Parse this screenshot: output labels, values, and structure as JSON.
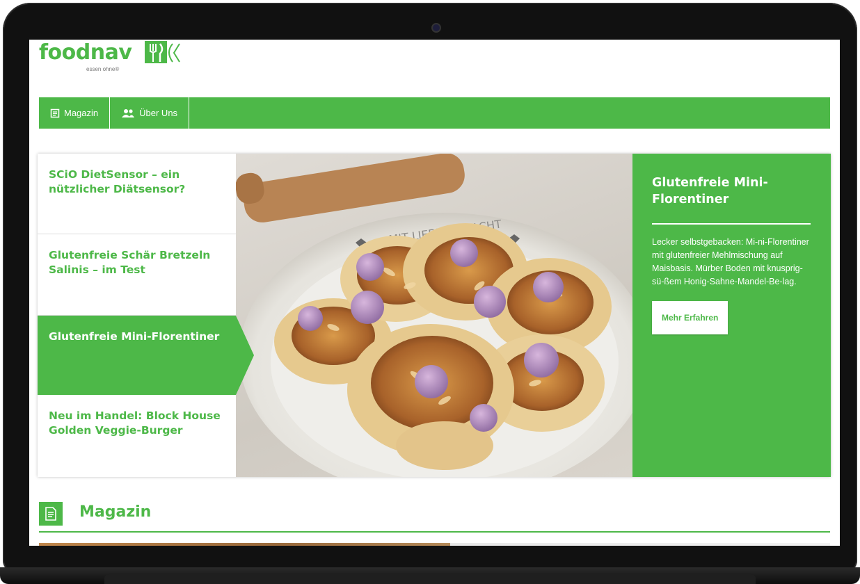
{
  "brand": {
    "name": "foodnav",
    "tagline": "essen ohne®",
    "accent": "#4db848"
  },
  "nav": {
    "items": [
      {
        "label": "Magazin",
        "icon": "document-icon"
      },
      {
        "label": "Über Uns",
        "icon": "users-icon"
      }
    ]
  },
  "slider": {
    "items": [
      {
        "title": "SCiO DietSensor – ein nützlicher Diätsensor?",
        "active": false
      },
      {
        "title": "Glutenfreie Schär Bretzeln Salinis – im Test",
        "active": false
      },
      {
        "title": "Glutenfreie Mini-Florentiner",
        "active": true
      },
      {
        "title": "Neu im Handel: Block House Golden Veggie-Burger",
        "active": false
      }
    ],
    "detail": {
      "title": "Glutenfreie Mini-Florentiner",
      "text": "Lecker selbstgebacken: Mi-ni-Florentiner mit glutenfreier Mehlmischung auf Maisbasis. Mürber Boden mit knusprig-sü-ßem Honig-Sahne-Mandel-Be-lag.",
      "button": "Mehr Erfahren"
    },
    "photo_plate_text": "MIT LIEBE GEMACHT"
  },
  "section": {
    "title": "Magazin",
    "icon": "document-icon"
  }
}
